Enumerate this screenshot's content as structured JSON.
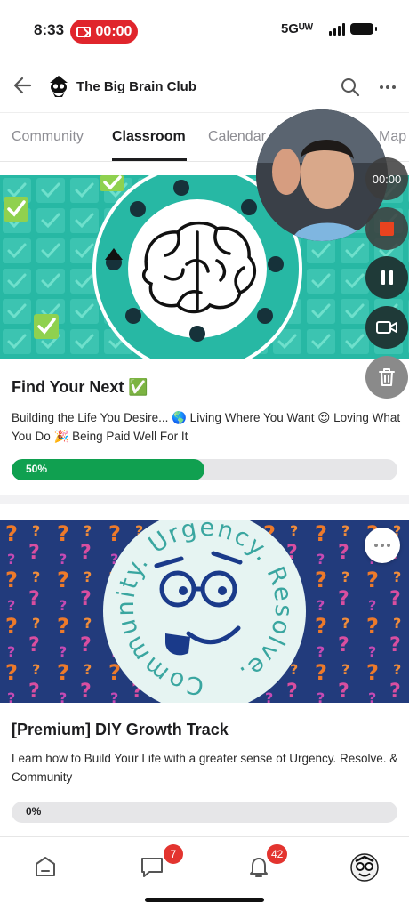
{
  "status_bar": {
    "time": "8:33",
    "recording_timer": "00:00",
    "network": "5Gᵁᵂ"
  },
  "header": {
    "club_name": "The Big Brain Club",
    "back_icon": "arrow-left-icon",
    "search_icon": "search-icon",
    "more_icon": "ellipsis-icon"
  },
  "tabs": [
    {
      "label": "Community",
      "active": false
    },
    {
      "label": "Classroom",
      "active": true
    },
    {
      "label": "Calendar",
      "active": false
    },
    {
      "label": "Map",
      "active": false
    }
  ],
  "courses": [
    {
      "title": "Find Your Next ✅",
      "description": "Building the Life You Desire... 🌎 Living Where You Want 😍 Loving What You Do 🎉 Being Paid Well For It",
      "progress_label": "50%",
      "progress": 0.5
    },
    {
      "title": "[Premium] DIY Growth Track",
      "description": "Learn how to Build Your Life with a greater sense of Urgency. Resolve. & Community",
      "progress_label": "0%",
      "progress": 0,
      "cover_circle_text": "Community. Urgency. Resolve."
    }
  ],
  "recorder": {
    "timer": "00:00",
    "controls": [
      "stop-icon",
      "pause-icon",
      "camera-icon",
      "trash-icon"
    ]
  },
  "bottom_nav": {
    "items": [
      "home-icon",
      "chat-icon",
      "bell-icon",
      "avatar"
    ],
    "chat_badge": "7",
    "notifications_badge": "42"
  },
  "colors": {
    "accent_green": "#10a050",
    "badge_red": "#e3342f",
    "recording_red": "#e0252c",
    "cover1_teal": "#27b8a4",
    "cover2_navy": "#223b7c"
  }
}
